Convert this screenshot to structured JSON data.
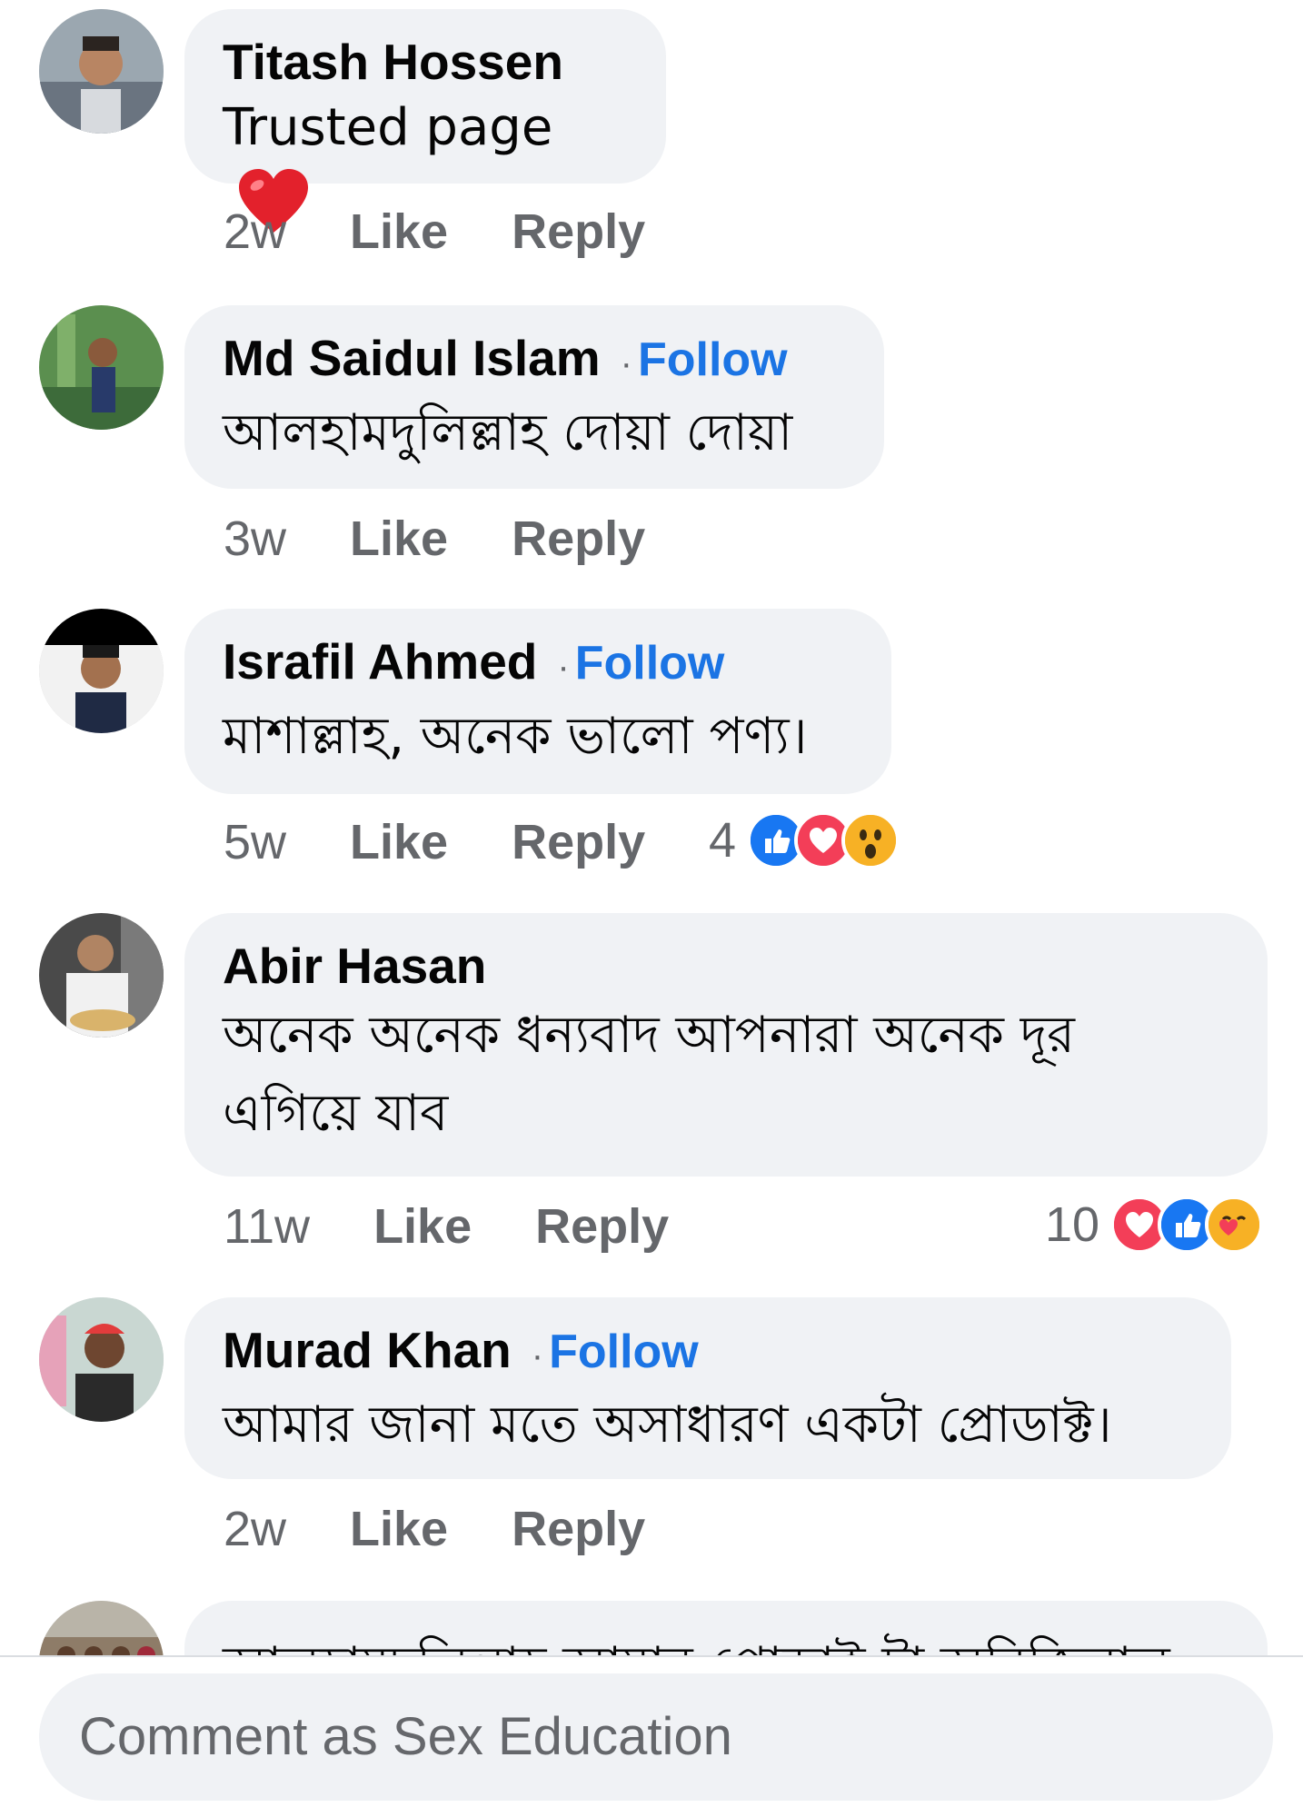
{
  "comments": [
    {
      "author": "Titash Hossen",
      "follow": "",
      "text": "Trusted page",
      "time": "2w",
      "like": "Like",
      "reply": "Reply",
      "reaction_count": "",
      "heart_emoji": true
    },
    {
      "author": "Md Saidul Islam",
      "follow": "Follow",
      "text": "আলহামদুলিল্লাহ দোয়া দোয়া",
      "time": "3w",
      "like": "Like",
      "reply": "Reply",
      "reaction_count": ""
    },
    {
      "author": "Israfil Ahmed",
      "follow": "Follow",
      "text": "মাশাল্লাহ, অনেক ভালো পণ্য।",
      "time": "5w",
      "like": "Like",
      "reply": "Reply",
      "reaction_count": "4",
      "reactions": [
        "like-reaction-icon",
        "love-reaction-icon",
        "wow-reaction-icon"
      ]
    },
    {
      "author": "Abir Hasan",
      "follow": "",
      "text": "অনেক অনেক ধন্যবাদ আপনারা অনেক দূর এগিয়ে যাব",
      "time": "11w",
      "like": "Like",
      "reply": "Reply",
      "reaction_count": "10",
      "reactions": [
        "love-reaction-icon",
        "like-reaction-icon",
        "care-reaction-icon"
      ]
    },
    {
      "author": "Murad Khan",
      "follow": "Follow",
      "text": "আমার জানা মতে অসাধারণ একটা প্রোডাক্ট।",
      "time": "2w",
      "like": "Like",
      "reply": "Reply",
      "reaction_count": ""
    }
  ],
  "partial_comment_text": "আলহামদুলিল্লাহ আমার প্রোডাক্ট টা অরিজিনাল",
  "composer": {
    "placeholder": "Comment as Sex Education"
  },
  "colors": {
    "accent": "#1b74e4",
    "bubble": "#f0f2f5",
    "secondary_text": "#65676b",
    "love": "#f33e58",
    "like": "#1877f2"
  }
}
